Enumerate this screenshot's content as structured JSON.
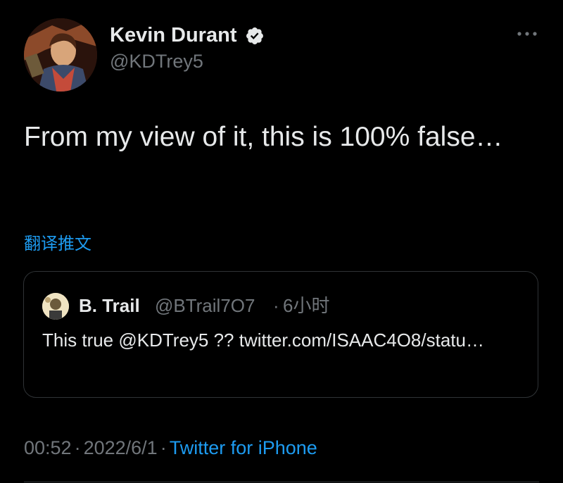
{
  "author": {
    "display_name": "Kevin Durant",
    "handle": "@KDTrey5",
    "verified": true,
    "avatar_icon": "avatar-photo"
  },
  "tweet": {
    "text": "From my view of it, this is 100% false…",
    "translate_label": "翻译推文"
  },
  "quoted_tweet": {
    "display_name": "B. Trail",
    "handle": "@BTrail7O7",
    "separator": "·",
    "time": "6小时",
    "text": "This true @KDTrey5 ?? twitter.com/ISAAC4O8/statu…"
  },
  "meta": {
    "time": "00:52",
    "separator": "·",
    "date": "2022/6/1",
    "source": "Twitter for iPhone"
  },
  "colors": {
    "background": "#000000",
    "text": "#e7e9ea",
    "muted": "#71767b",
    "accent": "#1d9bf0",
    "border": "#2f3336"
  }
}
